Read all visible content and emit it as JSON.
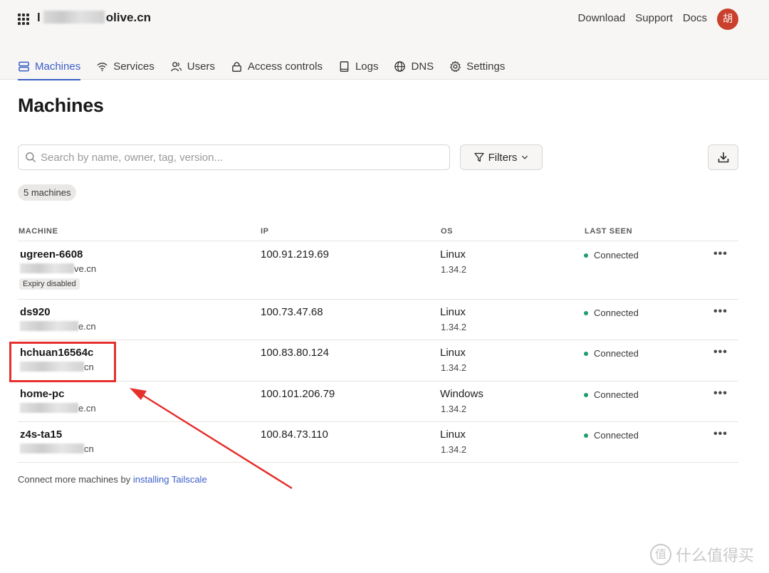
{
  "header": {
    "tenant_prefix": "l",
    "tenant_suffix": "olive.cn",
    "links": [
      "Download",
      "Support",
      "Docs"
    ],
    "avatar_text": "胡"
  },
  "tabs": [
    {
      "label": "Machines",
      "icon": "server-icon",
      "active": true
    },
    {
      "label": "Services",
      "icon": "wifi-icon",
      "active": false
    },
    {
      "label": "Users",
      "icon": "users-icon",
      "active": false
    },
    {
      "label": "Access controls",
      "icon": "lock-icon",
      "active": false
    },
    {
      "label": "Logs",
      "icon": "book-icon",
      "active": false
    },
    {
      "label": "DNS",
      "icon": "globe-icon",
      "active": false
    },
    {
      "label": "Settings",
      "icon": "gear-icon",
      "active": false
    }
  ],
  "page": {
    "title": "Machines",
    "search_placeholder": "Search by name, owner, tag, version...",
    "filters_label": "Filters",
    "count_label": "5 machines"
  },
  "table": {
    "headers": [
      "MACHINE",
      "IP",
      "OS",
      "LAST SEEN"
    ],
    "rows": [
      {
        "name": "ugreen-6608",
        "owner_suffix": "ve.cn",
        "badge": "Expiry disabled",
        "ip": "100.91.219.69",
        "os": "Linux",
        "version": "1.34.2",
        "status": "Connected"
      },
      {
        "name": "ds920",
        "owner_suffix": "e.cn",
        "ip": "100.73.47.68",
        "os": "Linux",
        "version": "1.34.2",
        "status": "Connected"
      },
      {
        "name": "hchuan16564c",
        "owner_suffix": "cn",
        "ip": "100.83.80.124",
        "os": "Linux",
        "version": "1.34.2",
        "status": "Connected"
      },
      {
        "name": "home-pc",
        "owner_suffix": "e.cn",
        "ip": "100.101.206.79",
        "os": "Windows",
        "version": "1.34.2",
        "status": "Connected"
      },
      {
        "name": "z4s-ta15",
        "owner_suffix": "cn",
        "ip": "100.84.73.110",
        "os": "Linux",
        "version": "1.34.2",
        "status": "Connected"
      }
    ],
    "more_glyph": "•••"
  },
  "footer": {
    "text": "Connect more machines by ",
    "link": "installing Tailscale"
  },
  "watermark": {
    "icon_text": "值",
    "text": "什么值得买"
  },
  "colors": {
    "accent": "#3b5ec7",
    "status_connected": "#1f9d6b",
    "annotation_red": "#e5302c",
    "avatar_bg": "#c9402c"
  }
}
